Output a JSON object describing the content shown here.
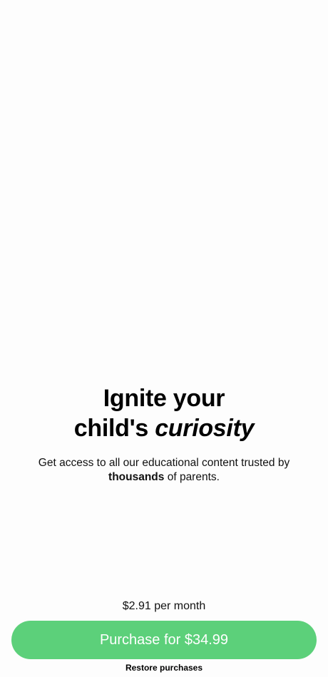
{
  "headline": {
    "line1": "Ignite your",
    "line2_prefix": "child's ",
    "line2_emphasis": "curiosity"
  },
  "subtitle": {
    "part1": "Get access to all our educational content trusted by",
    "emphasis": "thousands",
    "part2": " of parents."
  },
  "pricing": {
    "monthly_note": "$2.91 per month"
  },
  "actions": {
    "purchase_label": "Purchase for $34.99",
    "restore_label": "Restore purchases"
  },
  "colors": {
    "accent": "#5cd07a",
    "background": "#fdfdfd"
  }
}
